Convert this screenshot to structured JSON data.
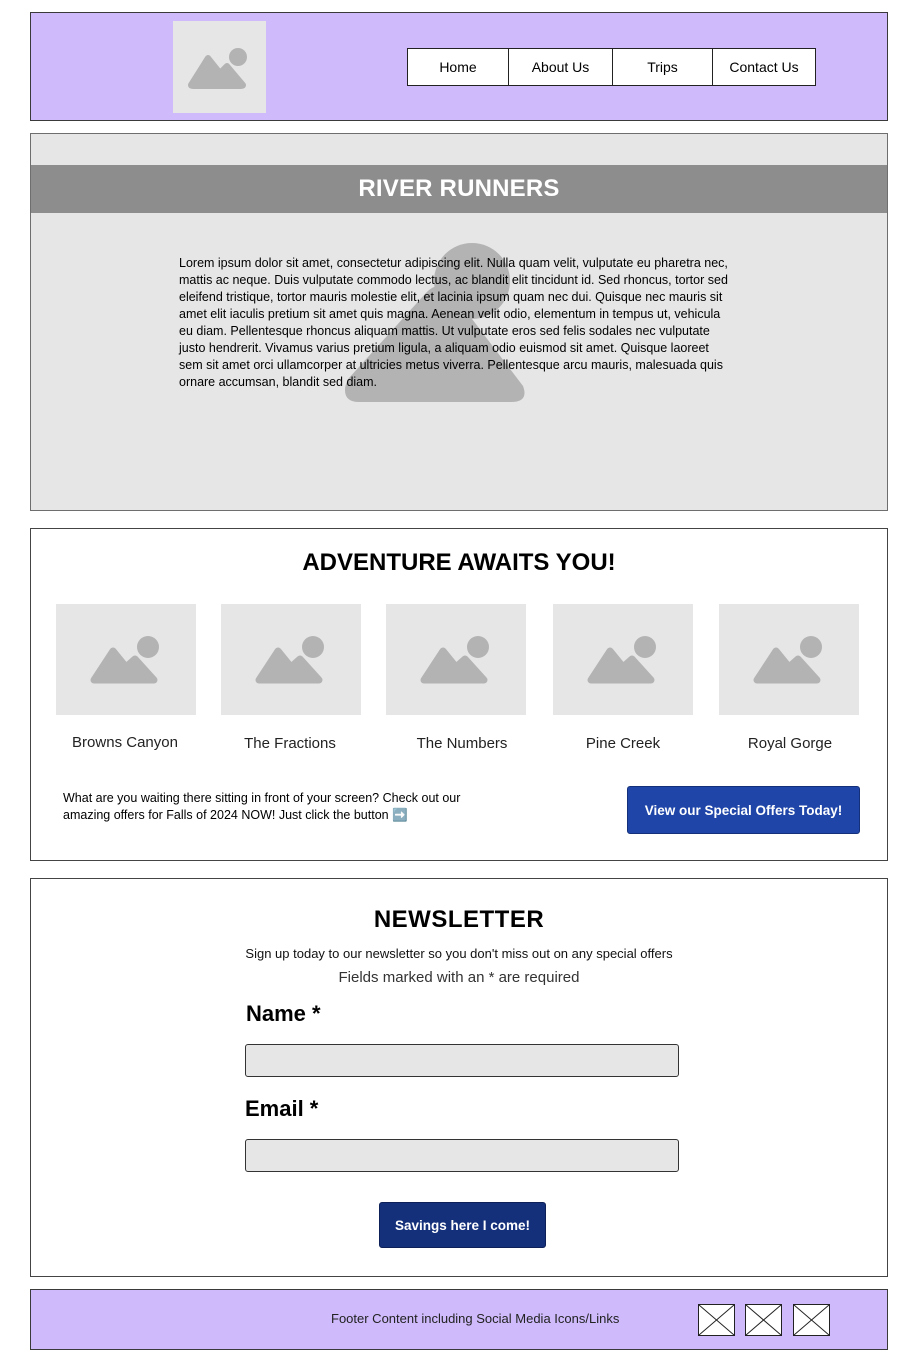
{
  "header": {
    "logo_icon": "image-placeholder-icon",
    "nav": [
      "Home",
      "About Us",
      "Trips",
      "Contact Us"
    ]
  },
  "hero": {
    "title": "RIVER RUNNERS",
    "placeholder_icon": "person-placeholder-icon",
    "body": "Lorem ipsum dolor sit amet, consectetur adipiscing elit. Nulla quam velit, vulputate eu pharetra nec, mattis ac neque. Duis vulputate commodo lectus, ac blandit elit tincidunt id. Sed rhoncus, tortor sed eleifend tristique, tortor mauris molestie elit, et lacinia ipsum quam nec dui. Quisque nec mauris sit amet elit iaculis pretium sit amet quis magna. Aenean velit odio, elementum in tempus ut, vehicula eu diam. Pellentesque rhoncus aliquam mattis. Ut vulputate eros sed felis sodales nec vulputate justo hendrerit. Vivamus varius pretium ligula, a aliquam odio euismod sit amet. Quisque laoreet sem sit amet orci ullamcorper at ultricies metus viverra. Pellentesque arcu mauris, malesuada quis ornare accumsan, blandit sed diam."
  },
  "adventure": {
    "title": "ADVENTURE AWAITS YOU!",
    "destinations": [
      {
        "name": "Browns Canyon"
      },
      {
        "name": "The Fractions"
      },
      {
        "name": "The Numbers"
      },
      {
        "name": "Pine Creek"
      },
      {
        "name": "Royal Gorge"
      }
    ],
    "promo_text": "What are you waiting there sitting in front of your screen? Check out our amazing offers for Falls of 2024 NOW! Just click the button ➡️",
    "button_label": "View our Special Offers Today!"
  },
  "newsletter": {
    "title": "NEWSLETTER",
    "description": "Sign up today to our newsletter so you don't miss out on any special offers",
    "required_note": "Fields marked with an * are required",
    "name_label": "Name *",
    "name_value": "",
    "email_label": "Email *",
    "email_value": "",
    "button_label": "Savings here I come!"
  },
  "footer": {
    "text": "Footer Content including Social Media Icons/Links",
    "social_icons": [
      "social-placeholder-icon",
      "social-placeholder-icon",
      "social-placeholder-icon"
    ]
  },
  "colors": {
    "header_bg": "#cfbbfb",
    "hero_band": "#8d8d8d",
    "placeholder_bg": "#e6e6e6",
    "placeholder_fg": "#b3b3b3",
    "offers_button": "#1f45a8",
    "submit_button": "#14307a"
  }
}
